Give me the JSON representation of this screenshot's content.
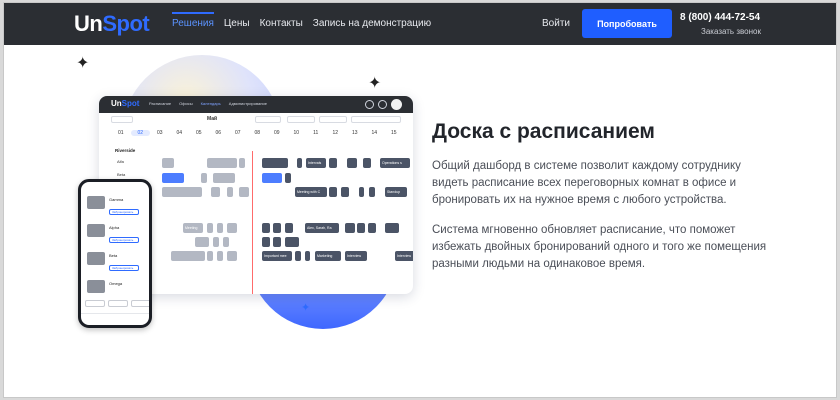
{
  "brand": {
    "un": "Un",
    "spot": "Spot"
  },
  "nav": {
    "items": [
      {
        "label": "Решения",
        "active": true
      },
      {
        "label": "Цены",
        "active": false
      },
      {
        "label": "Контакты",
        "active": false
      },
      {
        "label": "Запись на демонстрацию",
        "active": false
      }
    ]
  },
  "header": {
    "login": "Войти",
    "try_button": "Попробовать",
    "phone": "8 (800) 444-72-54",
    "callback": "Заказать звонок"
  },
  "colors": {
    "accent": "#1f5eff",
    "header_bg": "#2b2e33"
  },
  "feature": {
    "title": "Доска с расписанием",
    "paragraph1": "Общий дашборд в системе позволит каждому сотруднику видеть расписание всех переговорных комнат в офисе и бронировать их на нужное время с любого устройства.",
    "paragraph2": "Система мгновенно обновляет расписание, что поможет избежать двойных бронирований одного и того же помещения разными людьми на одинаковое время."
  },
  "dashboard": {
    "logo_un": "Un",
    "logo_spot": "Spot",
    "menu": [
      "Расписание",
      "Офисы",
      "Календарь",
      "Администрирование"
    ],
    "month": "Май",
    "days": [
      "01",
      "02",
      "03",
      "04",
      "05",
      "06",
      "07",
      "08",
      "09",
      "10",
      "11",
      "12",
      "13",
      "14",
      "15"
    ],
    "selected_day": "02",
    "location": "Riverside",
    "rooms": [
      "Alfa",
      "Beta"
    ],
    "events": [
      "Intervals",
      "Operations s",
      "Meeting with C",
      "Standup",
      "Meeting",
      "Alex, Sarah, Ra",
      "Marketing",
      "Interview",
      "Important mee",
      "Interview"
    ]
  },
  "mobile": {
    "rooms": [
      "Gamma",
      "Alpha",
      "Beta",
      "Omega"
    ],
    "button": "Забронировать"
  }
}
